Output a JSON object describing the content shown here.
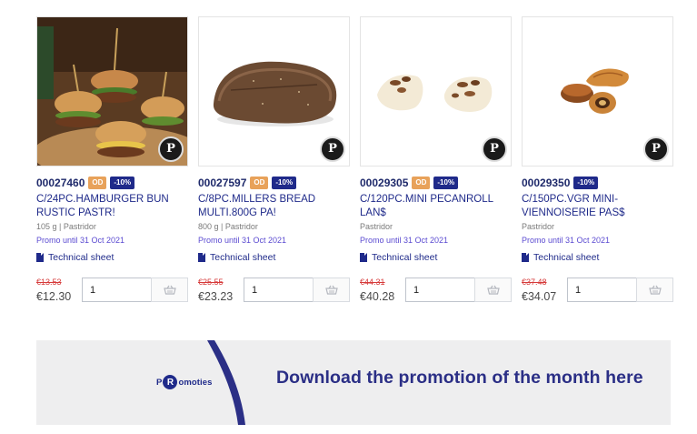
{
  "products": [
    {
      "code": "00027460",
      "od_badge": "OD",
      "discount_badge": "-10%",
      "name": "C/24PC.HAMBURGER BUN RUSTIC PASTR!",
      "meta": "105 g | Pastridor",
      "promo": "Promo until 31 Oct 2021",
      "tech_sheet": "Technical sheet",
      "old_price": "€13.53",
      "new_price": "€12.30",
      "qty": "1",
      "image_icon": "hamburger-buns-photo"
    },
    {
      "code": "00027597",
      "od_badge": "OD",
      "discount_badge": "-10%",
      "name": "C/8PC.MILLERS BREAD MULTI.800G PA!",
      "meta": "800 g | Pastridor",
      "promo": "Promo until 31 Oct 2021",
      "tech_sheet": "Technical sheet",
      "old_price": "€25.55",
      "new_price": "€23.23",
      "qty": "1",
      "image_icon": "bread-loaf-photo"
    },
    {
      "code": "00029305",
      "od_badge": "OD",
      "discount_badge": "-10%",
      "name": "C/120PC.MINI PECANROLL LAN$",
      "meta": "Pastridor",
      "promo": "Promo until 31 Oct 2021",
      "tech_sheet": "Technical sheet",
      "old_price": "€44.31",
      "new_price": "€40.28",
      "qty": "1",
      "image_icon": "pecan-rolls-photo"
    },
    {
      "code": "00029350",
      "discount_badge": "-10%",
      "name": "C/150PC.VGR MINI-VIENNOISERIE PAS$",
      "meta": "Pastridor",
      "promo": "Promo until 31 Oct 2021",
      "tech_sheet": "Technical sheet",
      "old_price": "€37.48",
      "new_price": "€34.07",
      "qty": "1",
      "image_icon": "viennoiserie-photo"
    }
  ],
  "banner": {
    "logo_letter": "R",
    "logo_text_pre": "P",
    "logo_text_post": "omoties",
    "title": "Download the promotion of the month here"
  },
  "colors": {
    "brand_navy": "#1f2a8a",
    "od_orange": "#e8a25a",
    "old_price_red": "#d63a3a",
    "promo_purple": "#5b4bd1",
    "banner_bg": "#eeeeef"
  }
}
